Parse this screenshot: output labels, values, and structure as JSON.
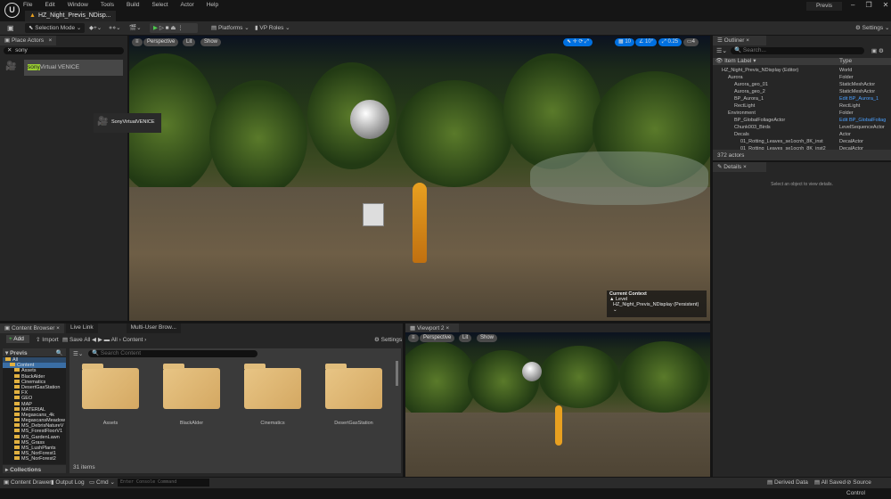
{
  "app": {
    "menu": [
      "File",
      "Edit",
      "Window",
      "Tools",
      "Build",
      "Select",
      "Actor",
      "Help"
    ],
    "doc_tab": "HZ_Night_Previs_NDisp...",
    "project": "Previs",
    "window_controls": [
      "–",
      "❐",
      "✕"
    ]
  },
  "toolbar": {
    "selection_mode": "Selection Mode",
    "platforms": "Platforms",
    "vp_roles": "VP Roles",
    "settings": "Settings"
  },
  "place_actors": {
    "title": "Place Actors",
    "search_value": "sony",
    "result_highlight": "sony",
    "result_rest": "Virtual VENICE",
    "drag_tooltip": "SonyVirtualVENICE"
  },
  "viewport": {
    "perspective": "Perspective",
    "lit": "Lit",
    "show": "Show",
    "grid_snap": "10",
    "rot_snap": "10°",
    "scale_snap": "0.25",
    "camera_speed": "4",
    "context_title": "Current Context",
    "context_level_label": "Level",
    "context_level": "HZ_Night_Previs_NDisplay (Persistent)"
  },
  "outliner": {
    "title": "Outliner",
    "search_placeholder": "Search...",
    "col_label": "Item Label",
    "col_type": "Type",
    "rows": [
      {
        "label": "HZ_Night_Previs_NDisplay (Editor)",
        "type": "World",
        "indent": 0
      },
      {
        "label": "Aurora",
        "type": "Folder",
        "indent": 1
      },
      {
        "label": "Aurora_geo_01",
        "type": "StaticMeshActor",
        "indent": 2
      },
      {
        "label": "Aurora_geo_2",
        "type": "StaticMeshActor",
        "indent": 2
      },
      {
        "label": "BP_Aurora_1",
        "type": "Edit BP_Aurora_1",
        "indent": 2,
        "link": true
      },
      {
        "label": "RectLight",
        "type": "RectLight",
        "indent": 2
      },
      {
        "label": "Environment",
        "type": "Folder",
        "indent": 1
      },
      {
        "label": "BP_GlobalFoliageActor",
        "type": "Edit BP_GlobalFoliag",
        "indent": 2,
        "link": true
      },
      {
        "label": "Chunk003_Birds",
        "type": "LevelSequenceActor",
        "indent": 2
      },
      {
        "label": "Decals",
        "type": "Actor",
        "indent": 2
      },
      {
        "label": "01_Rotting_Leaves_se1ocnh_8K_inst",
        "type": "DecalActor",
        "indent": 3
      },
      {
        "label": "01_Rotting_Leaves_se1ocnh_8K_inst2",
        "type": "DecalActor",
        "indent": 3
      }
    ],
    "count": "372 actors"
  },
  "details": {
    "title": "Details",
    "empty": "Select an object to view details."
  },
  "content_browser": {
    "tabs": [
      "Content Browser",
      "Live Link",
      "Multi-User Brow..."
    ],
    "add": "Add",
    "import": "Import",
    "save_all": "Save All",
    "breadcrumb": [
      "All",
      "Content"
    ],
    "settings": "Settings",
    "source_root": "Previs",
    "search_placeholder": "Search Content",
    "tree": [
      "All",
      "Content",
      "Assets",
      "BlackAlder",
      "Cinematics",
      "DesertGasStation",
      "FX",
      "GEO",
      "MAP",
      "MATERIAL",
      "Megascans_4k",
      "MegascansMeadow",
      "MS_DebrisNatureV",
      "MS_ForestFloorV1",
      "MS_GardenLawn",
      "MS_Grass",
      "MS_LushPlants",
      "MS_NorForest1",
      "MS_NorForest2"
    ],
    "folders": [
      "Assets",
      "BlackAlder",
      "Cinematics",
      "DesertGasStation"
    ],
    "collections": "Collections",
    "item_count": "31 items"
  },
  "viewport2": {
    "title": "Viewport 2",
    "perspective": "Perspective",
    "lit": "Lit",
    "show": "Show"
  },
  "statusbar": {
    "content_drawer": "Content Drawer",
    "output_log": "Output Log",
    "cmd": "Cmd",
    "console_placeholder": "Enter Console Command",
    "derived_data": "Derived Data",
    "all_saved": "All Saved",
    "source_control": "Source Control"
  },
  "colors": {
    "accent": "#0070e0",
    "play": "#4ec94e",
    "folder": "#e0bd7c",
    "highlight": "#9acd32"
  }
}
